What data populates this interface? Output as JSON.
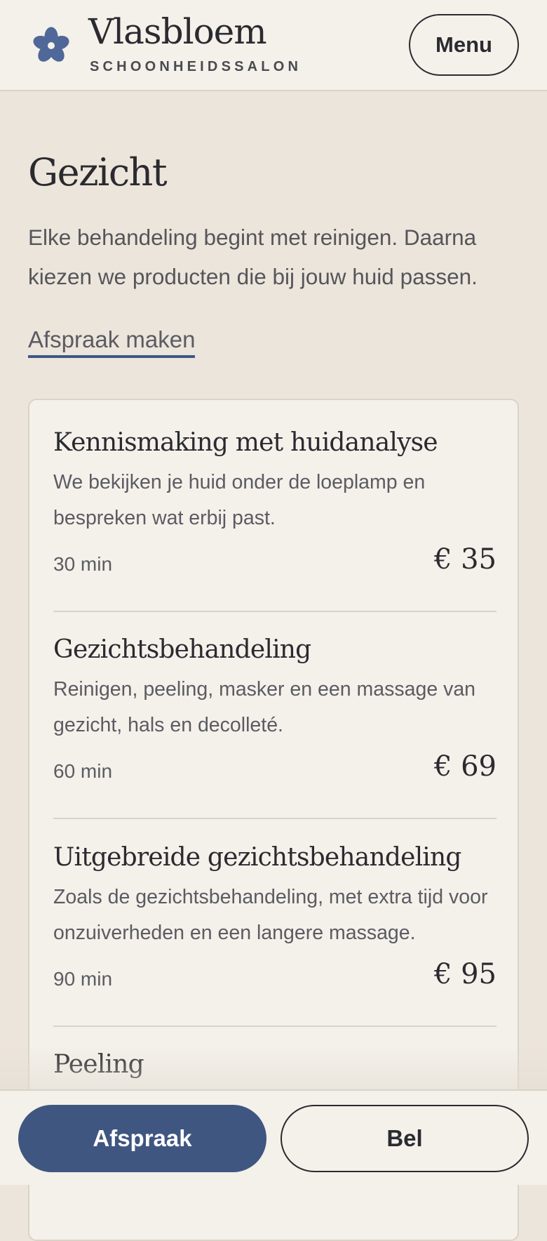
{
  "header": {
    "brand_name": "Vlasbloem",
    "brand_subtitle": "SCHOONHEIDSSALON",
    "logo_icon": "flower-icon",
    "menu_label": "Menu"
  },
  "page": {
    "title": "Gezicht",
    "intro": "Elke behandeling begint met reinigen. Daarna kiezen we producten die bij jouw huid passen.",
    "book_link": "Afspraak maken"
  },
  "treatments": [
    {
      "title": "Kennismaking met huidanalyse",
      "description": "We bekijken je huid onder de loeplamp en bespreken wat erbij past.",
      "duration": "30 min",
      "price": "€ 35"
    },
    {
      "title": "Gezichtsbehandeling",
      "description": "Reinigen, peeling, masker en een massage van gezicht, hals en decolleté.",
      "duration": "60 min",
      "price": "€ 69"
    },
    {
      "title": "Uitgebreide gezichtsbehandeling",
      "description": "Zoals de gezichtsbehandeling, met extra tijd voor onzuiverheden en een langere massage.",
      "duration": "90 min",
      "price": "€ 95"
    },
    {
      "title": "Peeling"
    }
  ],
  "actions": {
    "primary_label": "Afspraak",
    "secondary_label": "Bel"
  },
  "colors": {
    "accent": "#3F5681",
    "background": "#ECE5DB",
    "surface": "#F4F1EA",
    "text": "#2A2A30"
  }
}
